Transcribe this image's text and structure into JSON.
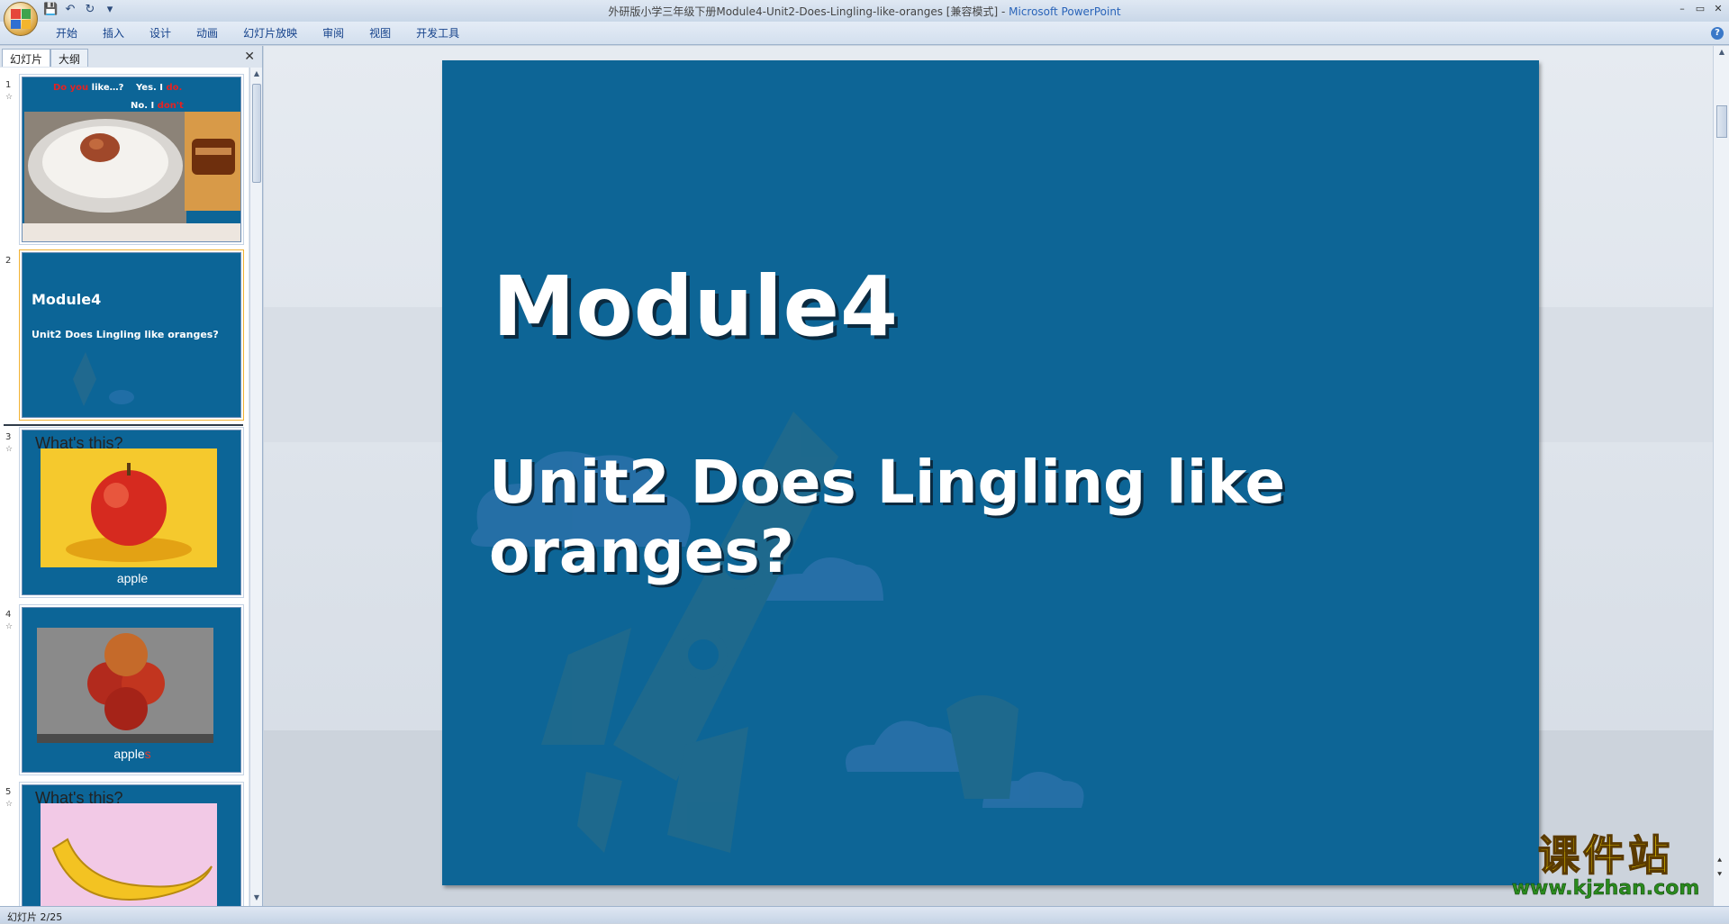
{
  "window": {
    "title_doc": "外研版小学三年级下册Module4-Unit2-Does-Lingling-like-oranges [兼容模式]",
    "title_sep": " - ",
    "title_app": "Microsoft PowerPoint"
  },
  "qat": {
    "save_glyph": "💾",
    "undo_glyph": "↶",
    "redo_glyph": "↻",
    "dropdown_glyph": "▾"
  },
  "ribbon": {
    "tabs": [
      "开始",
      "插入",
      "设计",
      "动画",
      "幻灯片放映",
      "审阅",
      "视图",
      "开发工具"
    ],
    "help": "?"
  },
  "window_buttons": {
    "minimize": "–",
    "restore": "▭",
    "close": "✕"
  },
  "left_panel": {
    "tab_slides": "幻灯片",
    "tab_outline": "大纲",
    "close": "✕",
    "thumbnails": [
      {
        "num": "1",
        "line1a": "Do you",
        "line1b": " like…?",
        "line1c": "Yes. I ",
        "line1d": "do.",
        "line2a": "No. I ",
        "line2b": "don't",
        "star": "☆"
      },
      {
        "num": "2",
        "title": "Module4",
        "subtitle": "Unit2 Does Lingling like oranges?"
      },
      {
        "num": "3",
        "question": "What's this?",
        "caption": "apple",
        "star": "☆"
      },
      {
        "num": "4",
        "caption_a": "apple",
        "caption_b": "s",
        "star": "☆"
      },
      {
        "num": "5",
        "question": "What's this?",
        "star": "☆"
      }
    ]
  },
  "slide": {
    "title": "Module4",
    "subtitle": "Unit2 Does Lingling like oranges?"
  },
  "status": {
    "text": "幻灯片 2/25"
  },
  "watermark": {
    "cn": "课件站",
    "url": "www.kjzhan.com"
  },
  "colors": {
    "slide_bg": "#0d6596",
    "selection": "#f2b233",
    "title_blue": "#2a64b9",
    "watermark_yellow": "#ffe100",
    "watermark_green": "#2a8a1e"
  }
}
